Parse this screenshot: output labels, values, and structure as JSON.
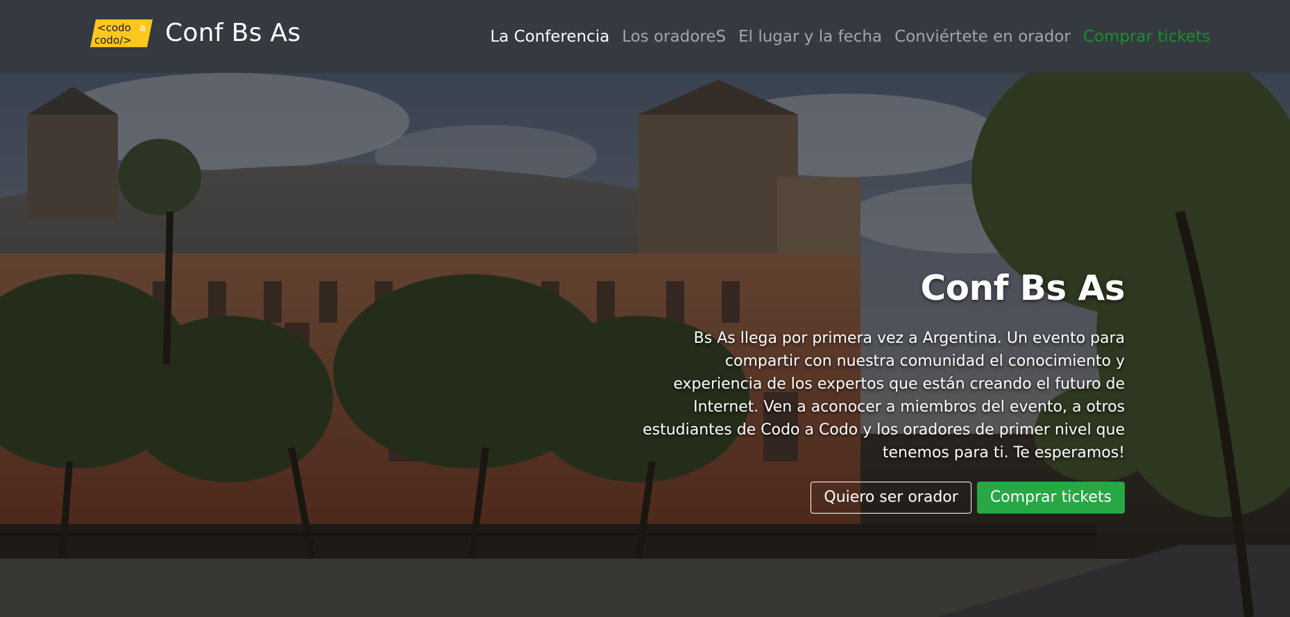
{
  "brand": {
    "logo_line1": "<codo",
    "logo_line1_suffix": "a",
    "logo_line2": "codo/>",
    "name": "Conf Bs As"
  },
  "nav": {
    "items": [
      {
        "label": "La Conferencia",
        "state": "active"
      },
      {
        "label": "Los oradoreS",
        "state": "default"
      },
      {
        "label": "El lugar y la fecha",
        "state": "default"
      },
      {
        "label": "Conviértete en orador",
        "state": "default"
      },
      {
        "label": "Comprar tickets",
        "state": "highlight"
      }
    ]
  },
  "hero": {
    "title": "Conf Bs As",
    "description": "Bs As llega por primera vez a Argentina. Un evento para compartir con nuestra comunidad el conocimiento y experiencia de los expertos que están creando el futuro de Internet. Ven a aconocer a miembros del evento, a otros estudiantes de Codo a Codo y los oradores de primer nivel que tenemos para ti. Te esperamos!",
    "button_speaker": "Quiero ser orador",
    "button_tickets": "Comprar tickets"
  },
  "colors": {
    "navbar_bg": "#343a40",
    "logo_yellow": "#fcc71e",
    "tickets_link": "#198f2a",
    "success_button": "#28a745"
  }
}
